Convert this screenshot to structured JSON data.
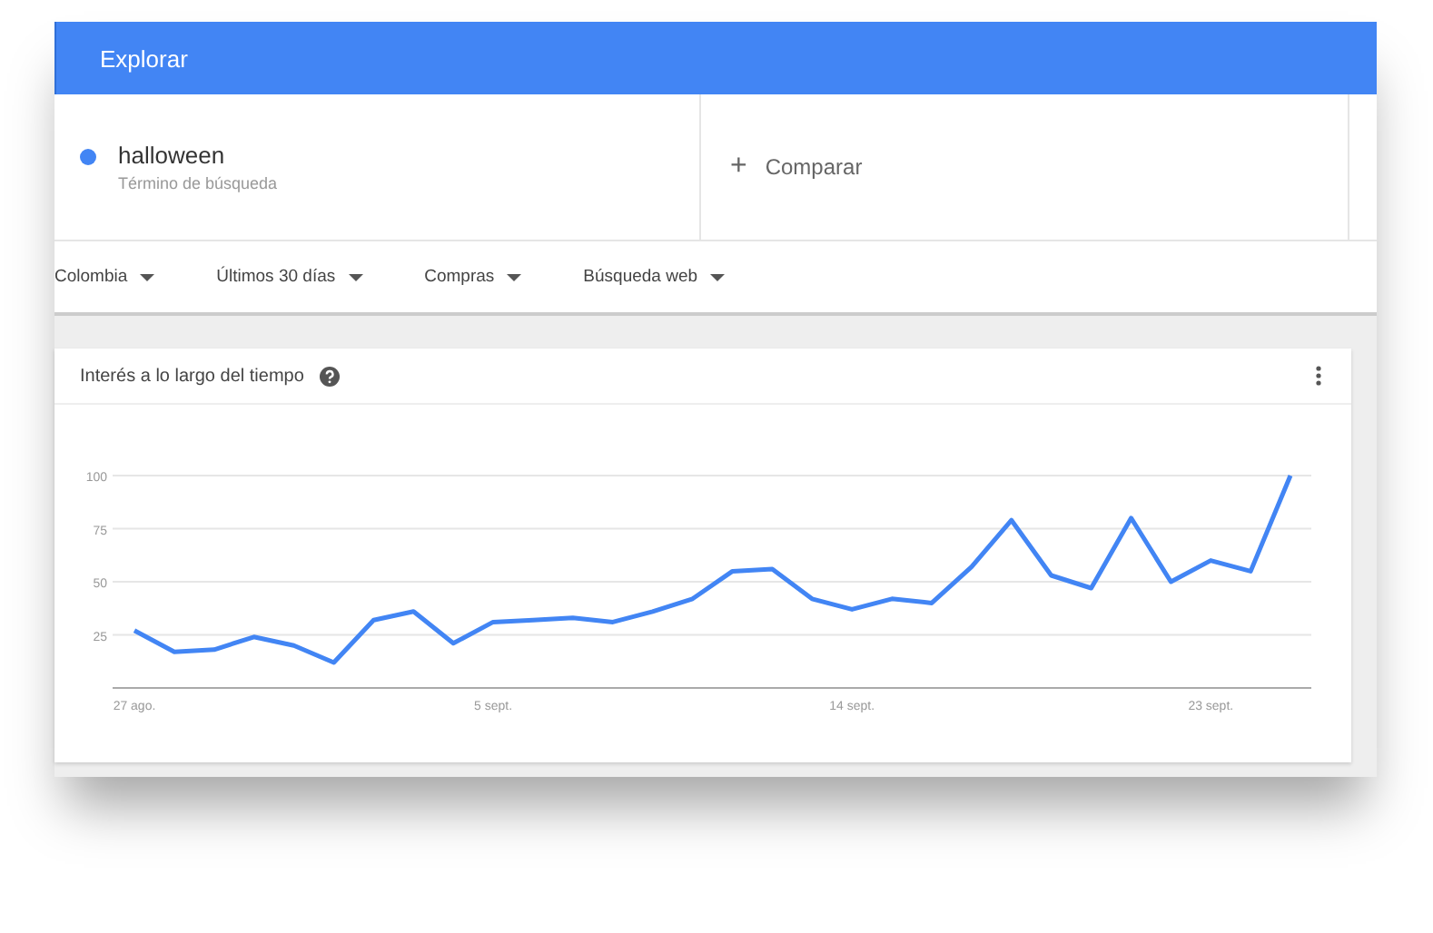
{
  "header": {
    "title": "Explorar"
  },
  "search_terms": [
    {
      "term": "halloween",
      "subtitle": "Término de búsqueda",
      "color": "#4285f4"
    }
  ],
  "compare": {
    "label": "Comparar",
    "icon": "+"
  },
  "filters": [
    {
      "label": "Colombia"
    },
    {
      "label": "Últimos 30 días"
    },
    {
      "label": "Compras"
    },
    {
      "label": "Búsqueda web"
    }
  ],
  "card": {
    "title": "Interés a lo largo del tiempo",
    "chart_data": {
      "type": "line",
      "categories": [
        "27 ago.",
        null,
        null,
        null,
        null,
        null,
        null,
        null,
        null,
        "5 sept.",
        null,
        null,
        null,
        null,
        null,
        null,
        null,
        null,
        "14 sept.",
        null,
        null,
        null,
        null,
        null,
        null,
        null,
        null,
        "23 sept.",
        null,
        null
      ],
      "ylim": [
        0,
        100
      ],
      "yticks": [
        25,
        50,
        75,
        100
      ],
      "grid": true,
      "series": [
        {
          "color": "#4285f4",
          "values": [
            27,
            17,
            18,
            24,
            20,
            12,
            32,
            36,
            21,
            31,
            32,
            33,
            31,
            36,
            42,
            55,
            56,
            42,
            37,
            42,
            40,
            57,
            79,
            53,
            47,
            80,
            50,
            60,
            55,
            100
          ]
        }
      ]
    }
  }
}
